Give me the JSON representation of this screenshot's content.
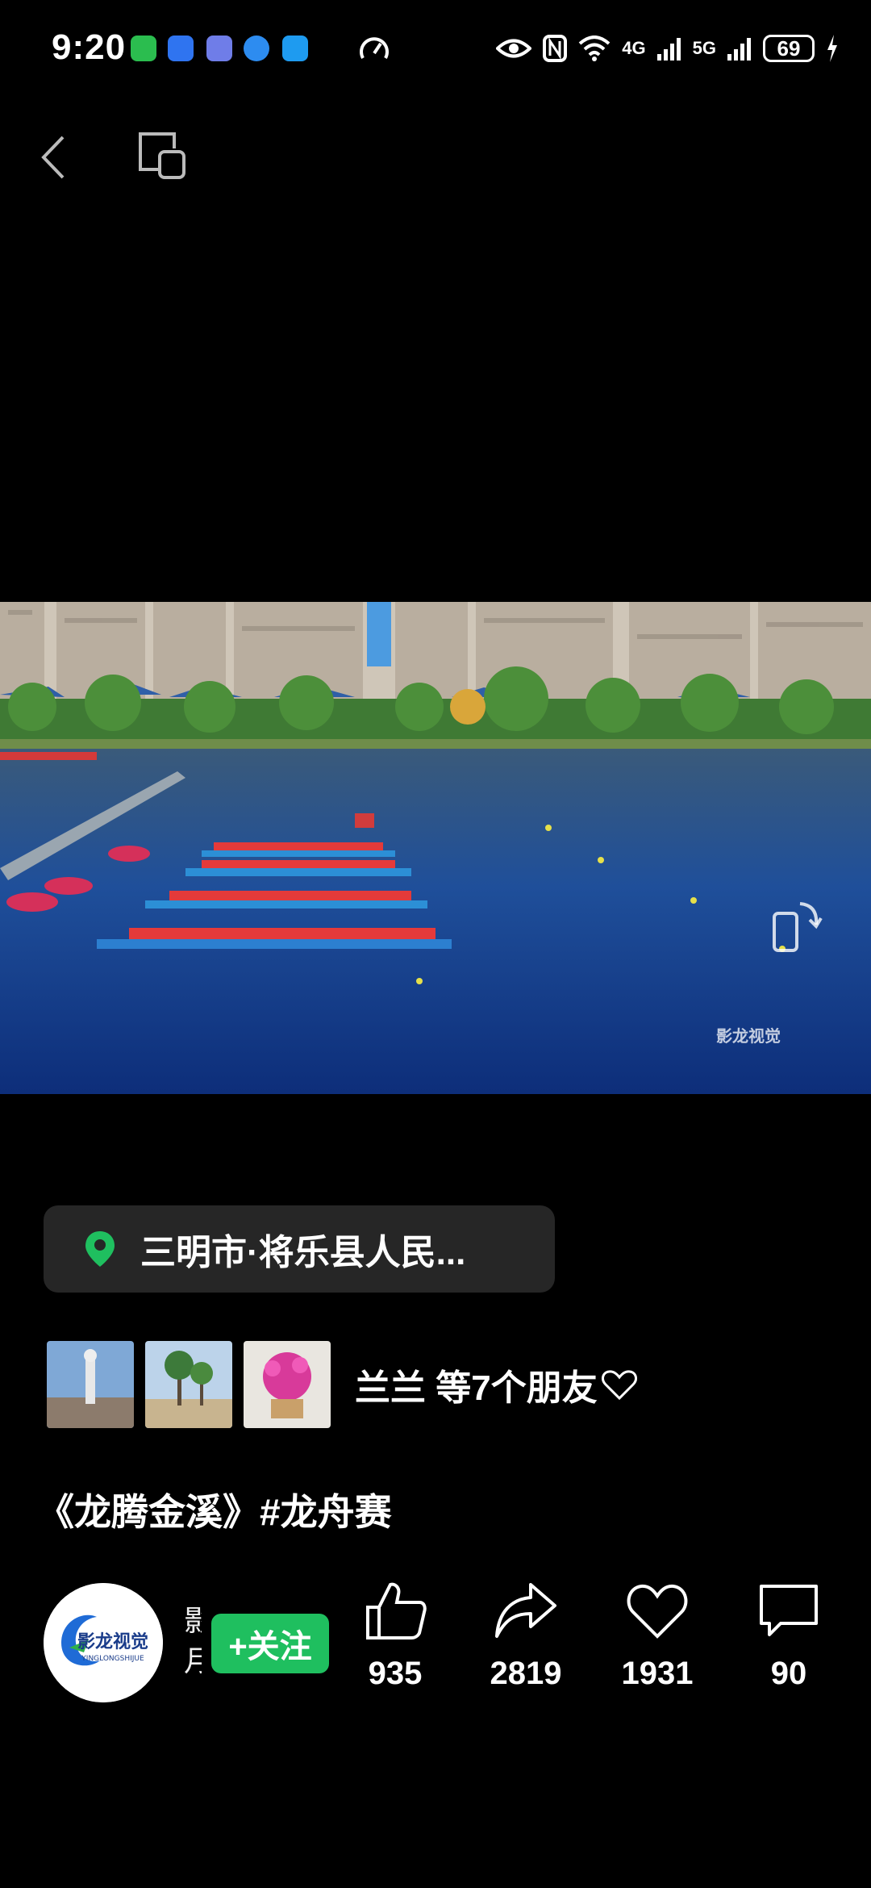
{
  "status_bar": {
    "time": "9:20",
    "battery": "69",
    "net1": "4G",
    "net2": "5G"
  },
  "video": {
    "watermark": "影龙视觉"
  },
  "location": {
    "text": "三明市·将乐县人民..."
  },
  "friends": {
    "text": "兰兰 等7个朋友"
  },
  "post": {
    "title": "《龙腾金溪》#龙舟赛"
  },
  "author": {
    "name_partial": "影 月",
    "follow_label": "+关注"
  },
  "actions": {
    "like_count": "935",
    "share_count": "2819",
    "favorite_count": "1931",
    "comment_count": "90"
  },
  "colors": {
    "accent_green": "#1fbf5f",
    "background": "#000000",
    "pill": "#262626"
  }
}
